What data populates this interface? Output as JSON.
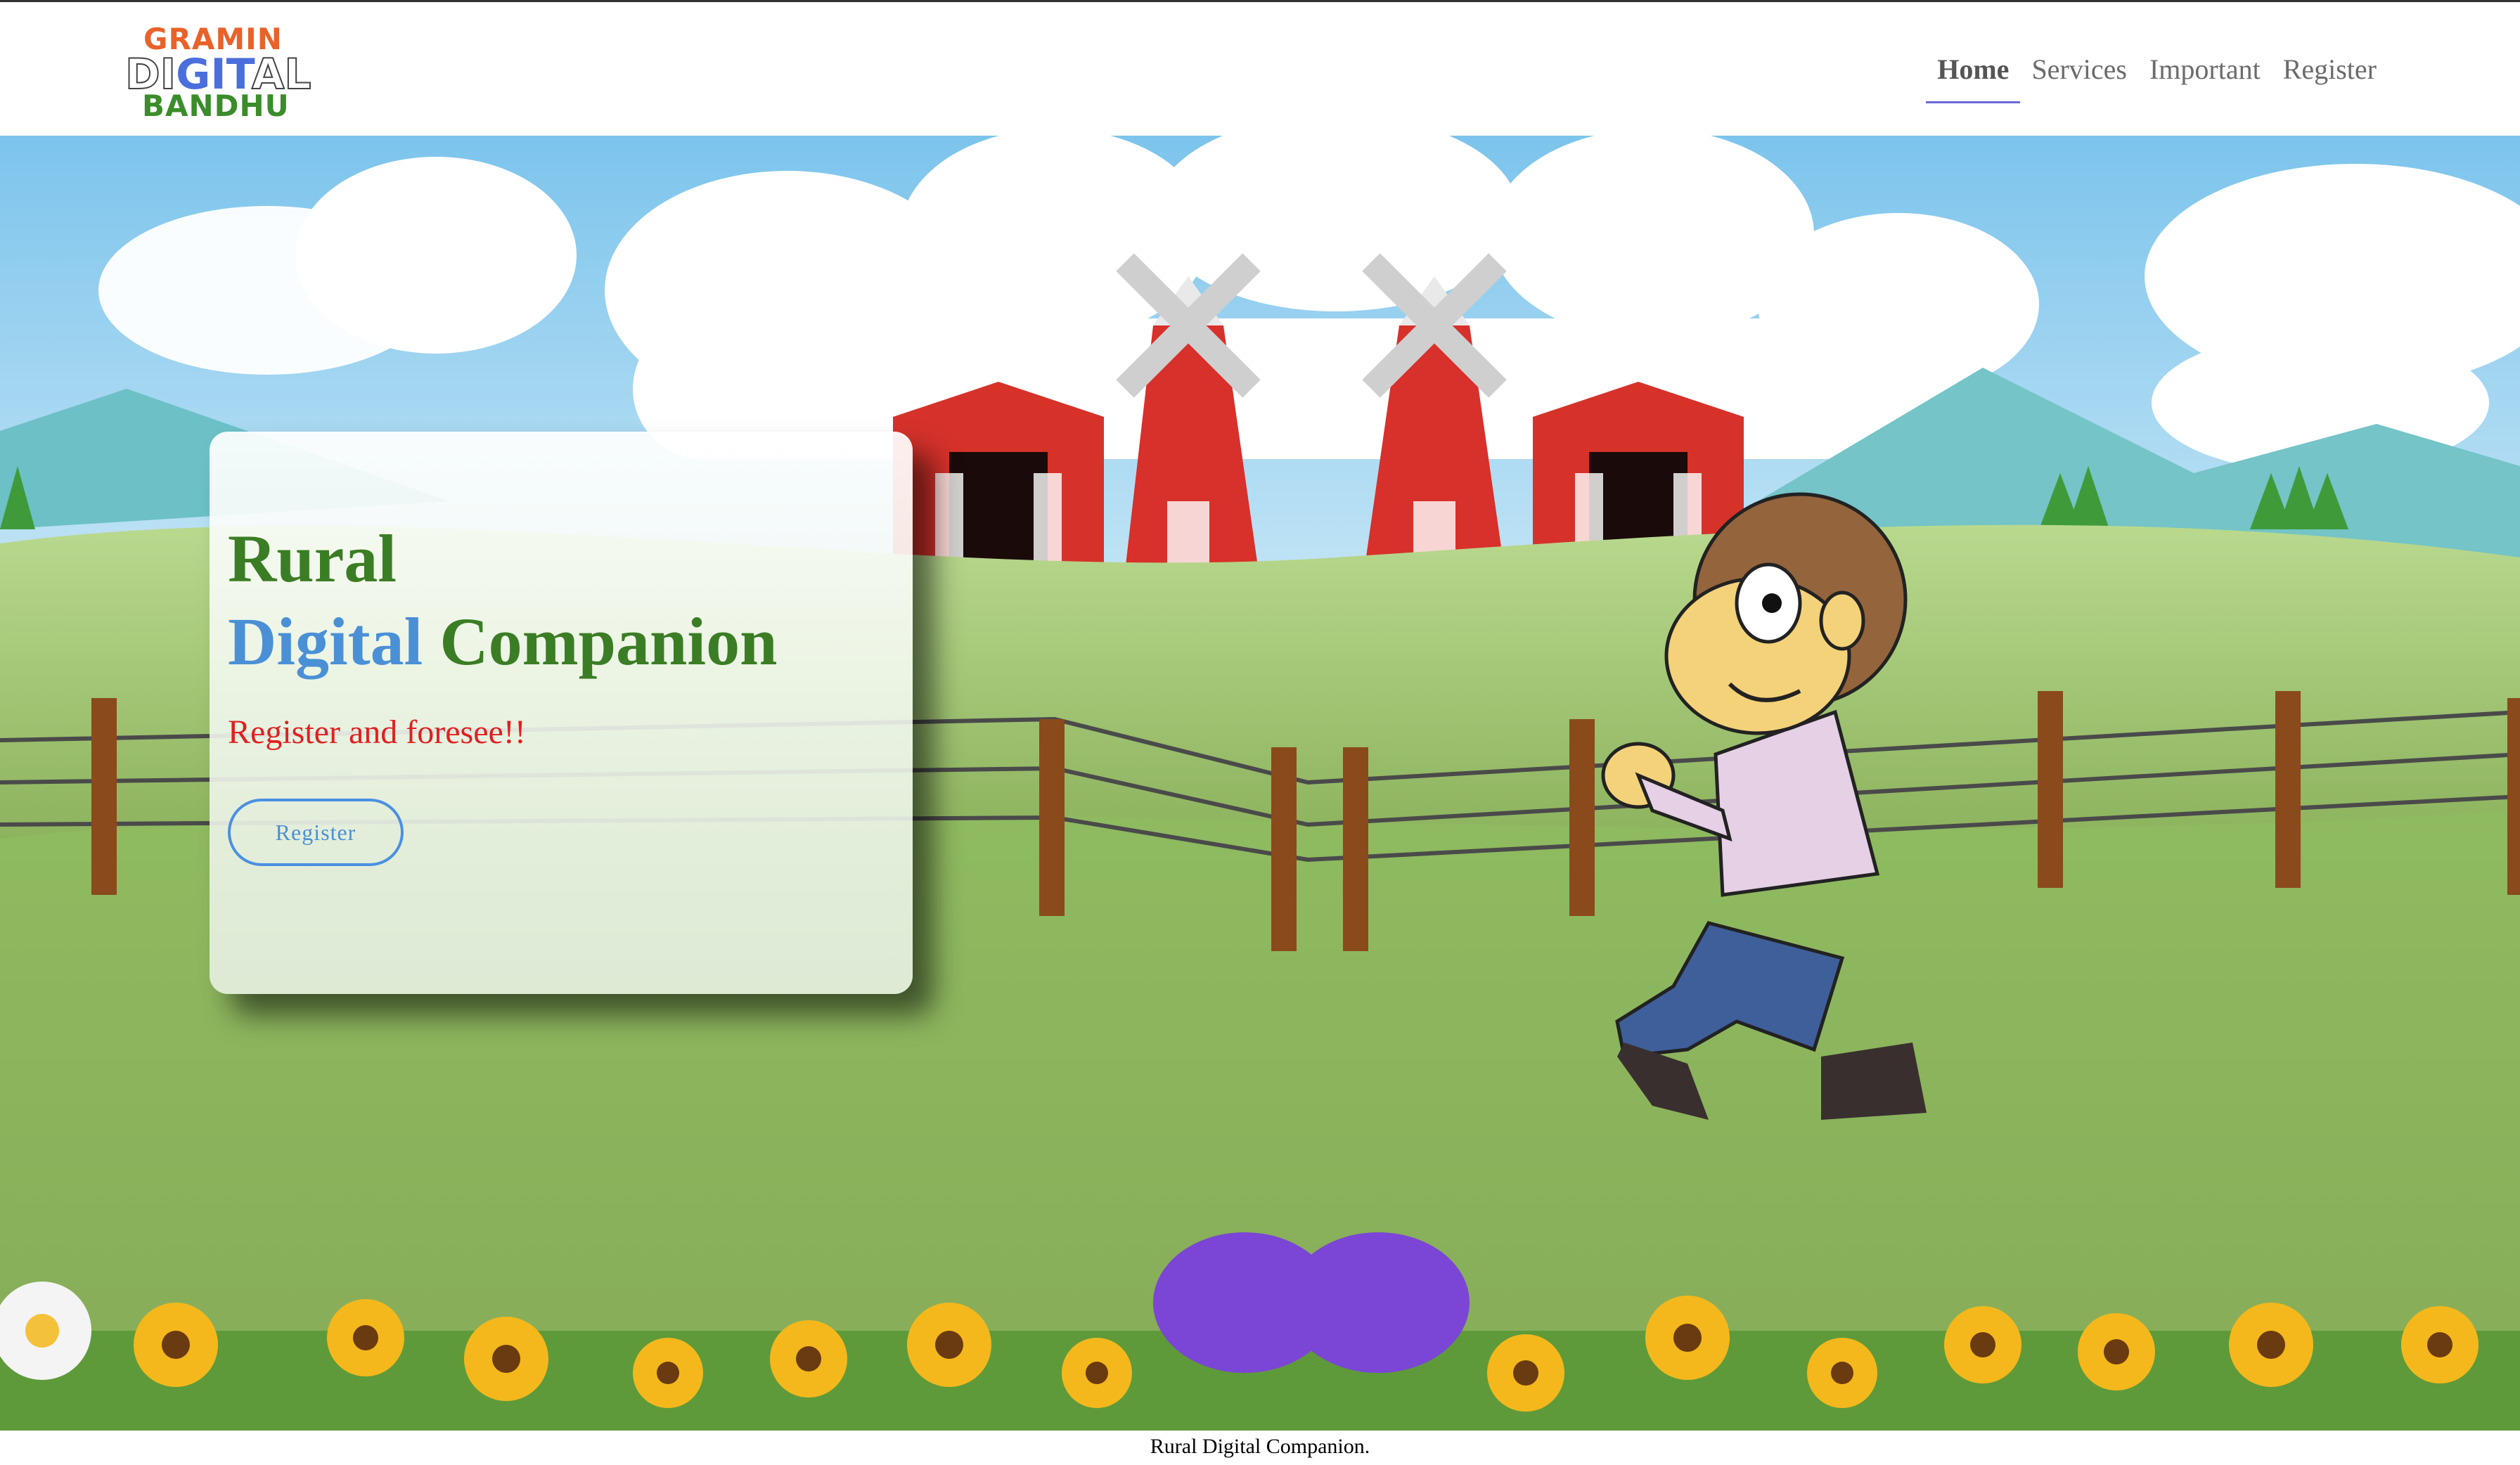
{
  "brand": {
    "line1": "GRAMIN",
    "line2_left": "DI",
    "line2_mid": "GIT",
    "line2_right": "AL",
    "line3": "BANDHU"
  },
  "nav": {
    "items": [
      {
        "label": "Home",
        "active": true
      },
      {
        "label": "Services",
        "active": false
      },
      {
        "label": "Important",
        "active": false
      },
      {
        "label": "Register",
        "active": false
      }
    ]
  },
  "hero": {
    "title_line1": "Rural",
    "title_word_blue": "Digital",
    "title_word_green": "Companion",
    "subtitle": "Register and foresee!!",
    "button_label": "Register"
  },
  "footer": {
    "text": "Rural Digital Companion."
  },
  "colors": {
    "title_green": "#3b7d24",
    "title_blue": "#4a90d6",
    "subtitle_red": "#e02020",
    "nav_underline": "#6a6ad6"
  }
}
